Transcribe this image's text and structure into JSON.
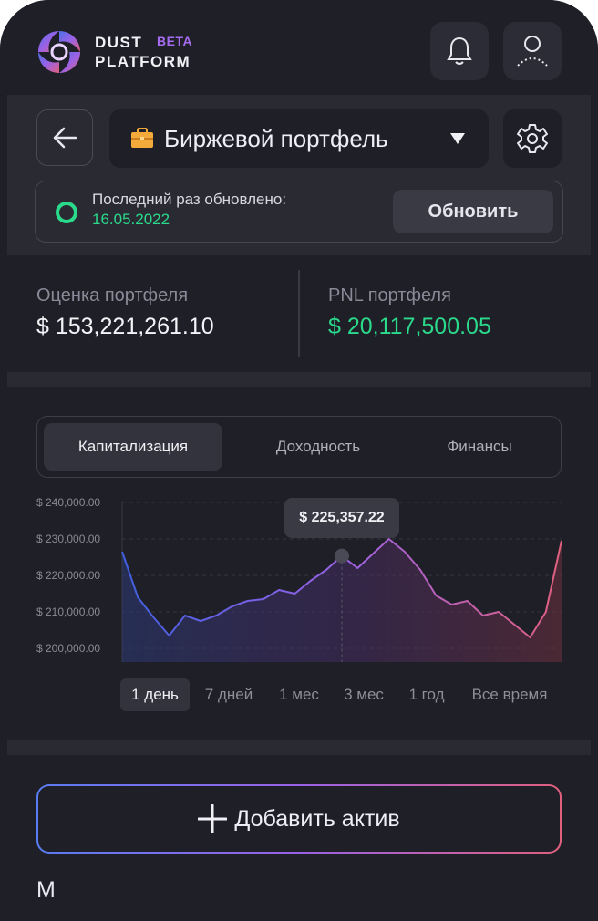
{
  "header": {
    "brand_line1": "DUST",
    "brand_line2": "PLATFORM",
    "beta": "BETA",
    "icons": [
      "bell-icon",
      "user-icon"
    ]
  },
  "portfolio": {
    "selected": "Биржевой портфель",
    "selector_icon": "briefcase-icon",
    "last_updated_label": "Последний раз обновлено:",
    "last_updated_date": "16.05.2022",
    "refresh_label": "Обновить"
  },
  "stats": {
    "value_label": "Оценка портфеля",
    "value": "$ 153,221,261.10",
    "pnl_label": "PNL портфеля",
    "pnl": "$ 20,117,500.05"
  },
  "tabs": [
    {
      "label": "Капитализация",
      "active": true
    },
    {
      "label": "Доходность",
      "active": false
    },
    {
      "label": "Финансы",
      "active": false
    }
  ],
  "periods": [
    {
      "label": "1 день",
      "active": true
    },
    {
      "label": "7 дней",
      "active": false
    },
    {
      "label": "1 мес",
      "active": false
    },
    {
      "label": "3 мес",
      "active": false
    },
    {
      "label": "1 год",
      "active": false
    },
    {
      "label": "Все время",
      "active": false
    }
  ],
  "add_asset_label": "Добавить актив",
  "cut_text": "М",
  "colors": {
    "background": "#1f1f27",
    "panel": "#2a2a33",
    "positive": "#2bd98b",
    "accent_purple": "#a66cf0",
    "gradient": [
      "#4f6fe8",
      "#9a62e6",
      "#e0607e"
    ]
  },
  "chart_data": {
    "type": "area",
    "yticks": [
      "$ 240,000.00",
      "$ 230,000.00",
      "$ 220,000.00",
      "$ 210,000.00",
      "$ 200,000.00"
    ],
    "ylim": [
      200000,
      240000
    ],
    "tooltip": "$ 225,357.22",
    "tooltip_index": 14,
    "grid": true,
    "values": [
      226500,
      214000,
      208500,
      203500,
      209000,
      207500,
      209000,
      211500,
      213000,
      213500,
      216000,
      215000,
      218500,
      221500,
      225357,
      222000,
      226000,
      230000,
      226500,
      221500,
      214500,
      212000,
      213000,
      209000,
      210000,
      206500,
      203000,
      210000,
      229500
    ]
  }
}
